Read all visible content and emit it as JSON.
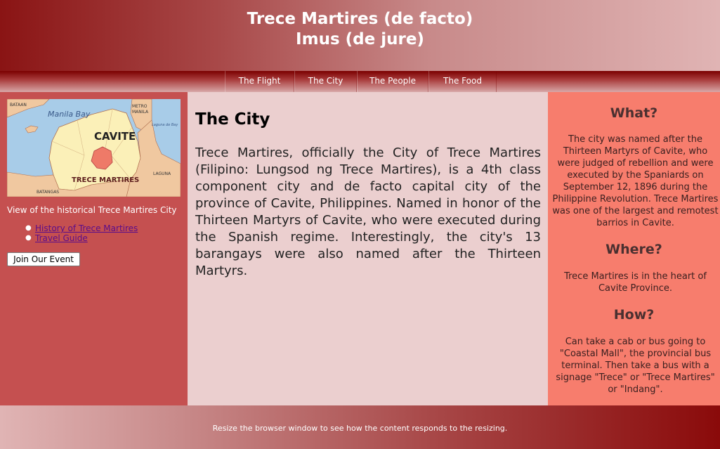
{
  "header": {
    "title_line1": "Trece Martires (de facto)",
    "title_line2": "Imus (de jure)"
  },
  "nav": {
    "items": [
      {
        "label": "The Flight"
      },
      {
        "label": "The City"
      },
      {
        "label": "The People"
      },
      {
        "label": "The Food"
      }
    ]
  },
  "sidebar": {
    "map": {
      "labels": {
        "bataan": "BATAAN",
        "manila_bay": "Manila Bay",
        "metro_manila": "METRO MANILA",
        "laguna_de_bay": "Laguna de Bay",
        "cavite": "CAVITE",
        "trece_martires": "TRECE MARTIRES",
        "laguna": "LAGUNA",
        "batangas": "BATANGAS"
      }
    },
    "caption": "View of the historical Trece Martires City",
    "links": [
      {
        "label": "History of Trece Martires"
      },
      {
        "label": "Travel Guide"
      }
    ],
    "button_label": "Join Our Event"
  },
  "main": {
    "heading": "The City",
    "body": "Trece Martires, officially the City of Trece Martires (Filipino: Lungsod ng Trece Martires), is a 4th class component city and de facto capital city of the province of Cavite, Philippines. Named in honor of the Thirteen Martyrs of Cavite, who were executed during the Spanish regime. Interestingly, the city's 13 barangays were also named after the Thirteen Martyrs."
  },
  "aside": {
    "what_heading": "What?",
    "what_text": "The city was named after the Thirteen Martyrs of Cavite, who were judged of rebellion and were executed by the Spaniards on September 12, 1896 during the Philippine Revolution. Trece Martires was one of the largest and remotest barrios in Cavite.",
    "where_heading": "Where?",
    "where_text": "Trece Martires is in the heart of Cavite Province.",
    "how_heading": "How?",
    "how_text": "Can take a cab or bus going to \"Coastal Mall\", the provincial bus terminal. Then take a bus with a signage \"Trece\" or \"Trece Martires\" or \"Indang\"."
  },
  "footer": {
    "text": "Resize the browser window to see how the content responds to the resizing."
  },
  "colors": {
    "header_dark": "#8a1414",
    "left_panel": "#c55050",
    "main_panel": "#ebcfcf",
    "right_panel": "#f77d6d",
    "link": "#5a0c8a"
  }
}
